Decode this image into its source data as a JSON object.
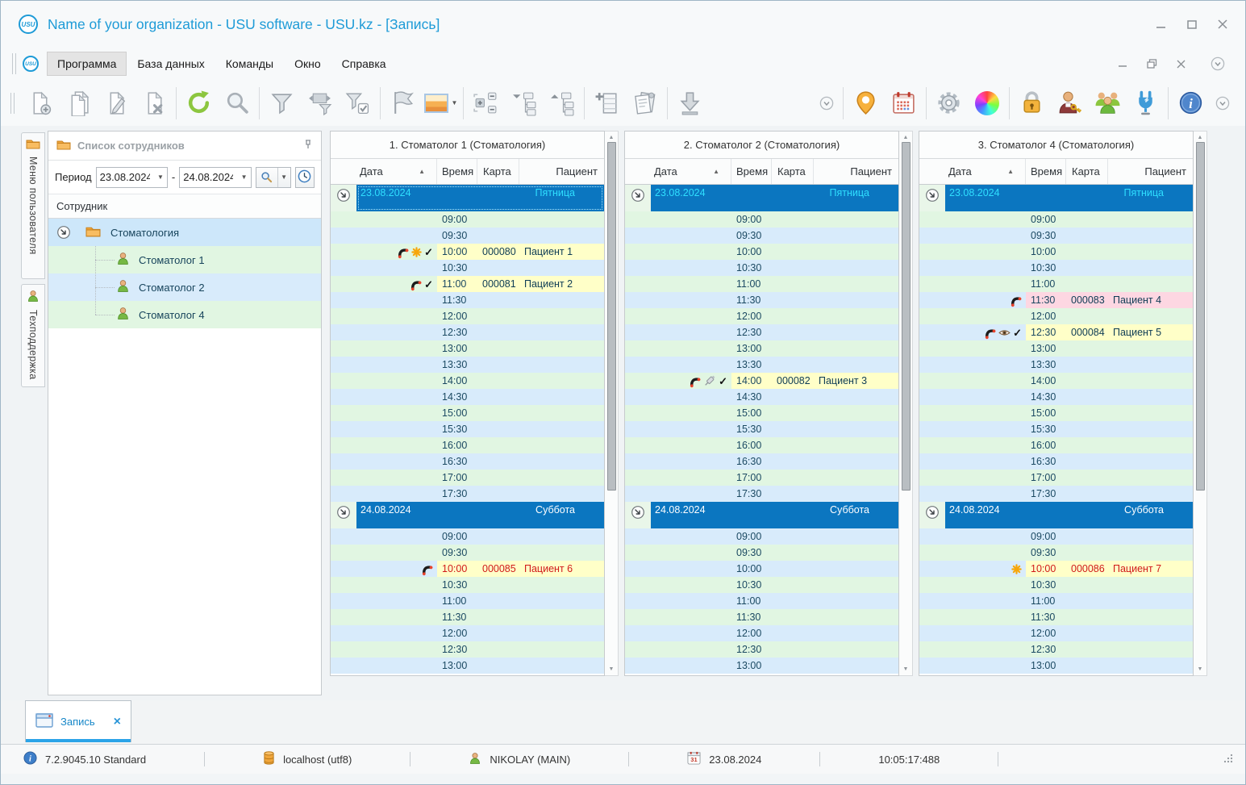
{
  "window": {
    "title": "Name of your organization - USU software - USU.kz - [Запись]",
    "logo_text": "USU"
  },
  "menu": {
    "items": [
      "Программа",
      "База данных",
      "Команды",
      "Окно",
      "Справка"
    ],
    "active_index": 0
  },
  "toolbar": {
    "left_sections": [
      [
        "doc-add",
        "doc-copy",
        "doc-edit",
        "doc-delete"
      ],
      [
        "refresh",
        "search"
      ],
      [
        "filter",
        "filter-columns",
        "filter-check"
      ],
      [
        "flag",
        "image-dropdown"
      ],
      [
        "tree-expand",
        "branch-collapse",
        "branch-expand"
      ],
      [
        "row-add",
        "report"
      ],
      [
        "download"
      ]
    ],
    "right_sections": [
      [
        "map-pin",
        "calendar"
      ],
      [
        "gear",
        "color-wheel"
      ],
      [
        "lock",
        "user-key",
        "users-group",
        "plug"
      ],
      [
        "info"
      ]
    ]
  },
  "left_tabs": [
    {
      "label": "Меню пользователя"
    },
    {
      "label": "Техподдержка"
    }
  ],
  "employee_panel": {
    "title": "Список сотрудников",
    "period_label": "Период",
    "date_from": "23.08.2024",
    "date_to": "24.08.2024",
    "separator": "-",
    "column_header": "Сотрудник",
    "group_label": "Стоматология",
    "employees": [
      "Стоматолог 1",
      "Стоматолог 2",
      "Стоматолог 4"
    ]
  },
  "schedule": {
    "headers": [
      "Дата",
      "Время",
      "Карта",
      "Пациент"
    ],
    "day_order": [
      "friday",
      "saturday"
    ],
    "day_templates": {
      "friday": {
        "date": "23.08.2024",
        "weekday": "Пятница",
        "today": true,
        "start_shade": "green",
        "times": [
          "09:00",
          "09:30",
          "10:00",
          "10:30",
          "11:00",
          "11:30",
          "12:00",
          "12:30",
          "13:00",
          "13:30",
          "14:00",
          "14:30",
          "15:00",
          "15:30",
          "16:00",
          "16:30",
          "17:00",
          "17:30"
        ]
      },
      "saturday": {
        "date": "24.08.2024",
        "weekday": "Суббота",
        "today": false,
        "start_shade": "blue",
        "times": [
          "09:00",
          "09:30",
          "10:00",
          "10:30",
          "11:00",
          "11:30",
          "12:00",
          "12:30",
          "13:00"
        ]
      }
    },
    "columns": [
      {
        "title": "1. Стоматолог 1 (Стоматология)",
        "focus_day": "friday",
        "appointments": [
          {
            "day": "friday",
            "time": "10:00",
            "card": "000080",
            "patient": "Пациент 1",
            "icons": [
              "phone",
              "asterisk",
              "check"
            ],
            "highlight": "yellow",
            "red": false
          },
          {
            "day": "friday",
            "time": "11:00",
            "card": "000081",
            "patient": "Пациент 2",
            "icons": [
              "phone",
              "check"
            ],
            "highlight": "yellow",
            "red": false
          },
          {
            "day": "saturday",
            "time": "10:00",
            "card": "000085",
            "patient": "Пациент 6",
            "icons": [
              "phone"
            ],
            "highlight": "yellow",
            "red": true
          }
        ]
      },
      {
        "title": "2. Стоматолог 2 (Стоматология)",
        "focus_day": null,
        "appointments": [
          {
            "day": "friday",
            "time": "14:00",
            "card": "000082",
            "patient": "Пациент 3",
            "icons": [
              "phone",
              "syringe",
              "check"
            ],
            "highlight": "yellow",
            "red": false
          }
        ]
      },
      {
        "title": "3. Стоматолог 4 (Стоматология)",
        "focus_day": null,
        "appointments": [
          {
            "day": "friday",
            "time": "11:30",
            "card": "000083",
            "patient": "Пациент 4",
            "icons": [
              "phone"
            ],
            "highlight": "pink",
            "red": false
          },
          {
            "day": "friday",
            "time": "12:30",
            "card": "000084",
            "patient": "Пациент 5",
            "icons": [
              "phone",
              "eye",
              "check"
            ],
            "highlight": "yellow",
            "red": false
          },
          {
            "day": "saturday",
            "time": "10:00",
            "card": "000086",
            "patient": "Пациент 7",
            "icons": [
              "asterisk"
            ],
            "highlight": "yellow",
            "red": true
          }
        ]
      }
    ]
  },
  "bottom_tab": {
    "label": "Запись",
    "close": "×"
  },
  "status_bar": {
    "version": "7.2.9045.10 Standard",
    "database": "localhost (utf8)",
    "user": "NIKOLAY (MAIN)",
    "date": "23.08.2024",
    "time": "10:05:17:488"
  },
  "colors": {
    "accent_blue": "#0b76c0",
    "today_text": "#2fdfff",
    "row_green": "#e1f6e2",
    "row_blue": "#d8ebfb",
    "appointment_yellow": "#ffffc8",
    "appointment_pink": "#fdd7e2",
    "alert_red": "#d11a1a",
    "title_blue": "#1e9bd7"
  }
}
